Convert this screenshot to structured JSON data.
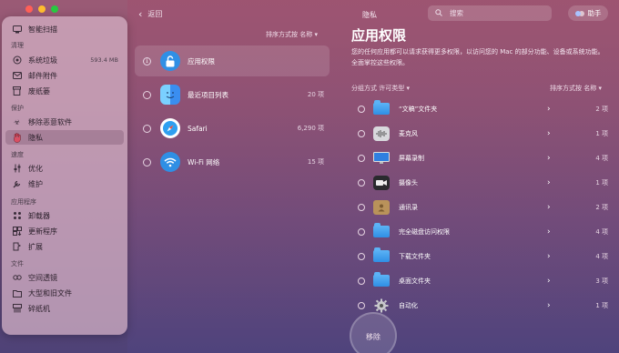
{
  "window": {
    "back_label": "返回",
    "privacy_title": "隐私",
    "search_placeholder": "搜索",
    "helper_label": "助手"
  },
  "sidebar": {
    "smart_scan": "智能扫描",
    "sections": [
      {
        "title": "清理",
        "items": [
          {
            "label": "系统垃圾",
            "icon": "trash-bin-icon",
            "size": "593.4 MB"
          },
          {
            "label": "邮件附件",
            "icon": "mail-icon"
          },
          {
            "label": "废纸篓",
            "icon": "bin-icon"
          }
        ]
      },
      {
        "title": "保护",
        "items": [
          {
            "label": "移除恶意软件",
            "icon": "biohazard-icon"
          },
          {
            "label": "隐私",
            "icon": "hand-icon"
          }
        ]
      },
      {
        "title": "速度",
        "items": [
          {
            "label": "优化",
            "icon": "sliders-icon"
          },
          {
            "label": "维护",
            "icon": "wrench-icon"
          }
        ]
      },
      {
        "title": "应用程序",
        "items": [
          {
            "label": "卸载器",
            "icon": "uninstaller-icon"
          },
          {
            "label": "更新程序",
            "icon": "updater-icon"
          },
          {
            "label": "扩展",
            "icon": "extensions-icon"
          }
        ]
      },
      {
        "title": "文件",
        "items": [
          {
            "label": "空间透镜",
            "icon": "space-lens-icon"
          },
          {
            "label": "大型和旧文件",
            "icon": "folder-icon"
          },
          {
            "label": "碎纸机",
            "icon": "shredder-icon"
          }
        ]
      }
    ]
  },
  "middle": {
    "sort_label": "排序方式按 名称 ▾",
    "items": [
      {
        "label": "应用权限",
        "count": "",
        "icon": "lock-icon"
      },
      {
        "label": "最近项目列表",
        "count": "20 项",
        "icon": "finder-icon"
      },
      {
        "label": "Safari",
        "count": "6,290 项",
        "icon": "safari-icon"
      },
      {
        "label": "Wi-Fi 网络",
        "count": "15 项",
        "icon": "wifi-icon"
      }
    ]
  },
  "right": {
    "title": "应用权限",
    "description": "您的任何应用都可以请求获得更多权限，以访问您的 Mac 的部分功能、设备或系统功能。全面掌控这些权限。",
    "group_label": "分组方式 许可类型 ▾",
    "sort_label": "排序方式按 名称 ▾",
    "items": [
      {
        "label": "“文稿”文件夹",
        "count": "2 项",
        "icon": "folder-icon"
      },
      {
        "label": "麦克风",
        "count": "1 项",
        "icon": "microphone-icon"
      },
      {
        "label": "屏幕录制",
        "count": "4 项",
        "icon": "screen-recording-icon"
      },
      {
        "label": "摄像头",
        "count": "1 项",
        "icon": "camera-icon"
      },
      {
        "label": "通讯录",
        "count": "2 项",
        "icon": "contacts-icon"
      },
      {
        "label": "完全磁盘访问权限",
        "count": "4 项",
        "icon": "folder-icon"
      },
      {
        "label": "下载文件夹",
        "count": "4 项",
        "icon": "folder-icon"
      },
      {
        "label": "桌面文件夹",
        "count": "3 项",
        "icon": "folder-icon"
      },
      {
        "label": "自动化",
        "count": "1 项",
        "icon": "gear-icon"
      }
    ],
    "remove_label": "移除"
  }
}
